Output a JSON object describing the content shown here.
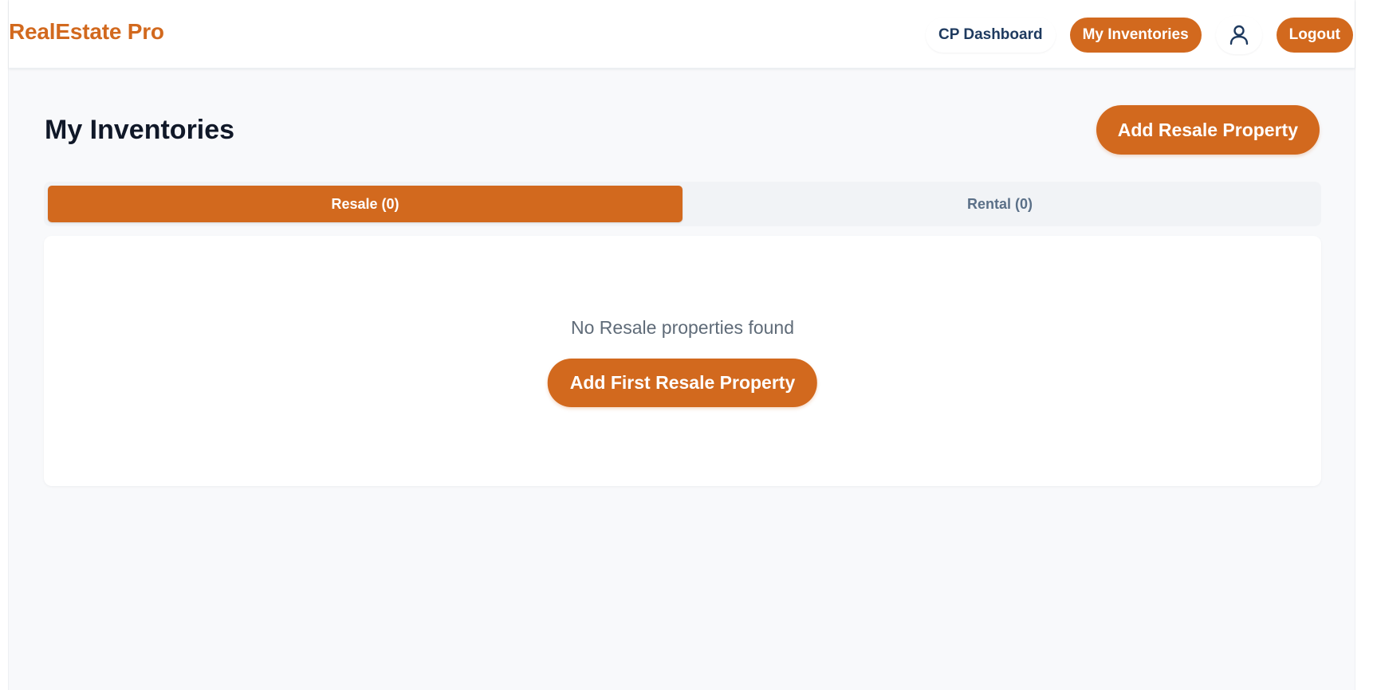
{
  "brand": {
    "name": "RealEstate Pro"
  },
  "nav": {
    "dashboard_label": "CP Dashboard",
    "inventories_label": "My Inventories",
    "profile_icon": "user-icon",
    "logout_label": "Logout"
  },
  "page": {
    "title": "My Inventories",
    "add_button_label": "Add Resale Property"
  },
  "tabs": [
    {
      "label": "Resale (0)",
      "active": true
    },
    {
      "label": "Rental (0)",
      "active": false
    }
  ],
  "empty_state": {
    "message": "No Resale properties found",
    "button_label": "Add First Resale Property"
  },
  "colors": {
    "accent": "#d2691e",
    "title": "#101828",
    "nav_text": "#1e3a5f",
    "muted": "#5f6b78",
    "background": "#f8f9fb"
  }
}
